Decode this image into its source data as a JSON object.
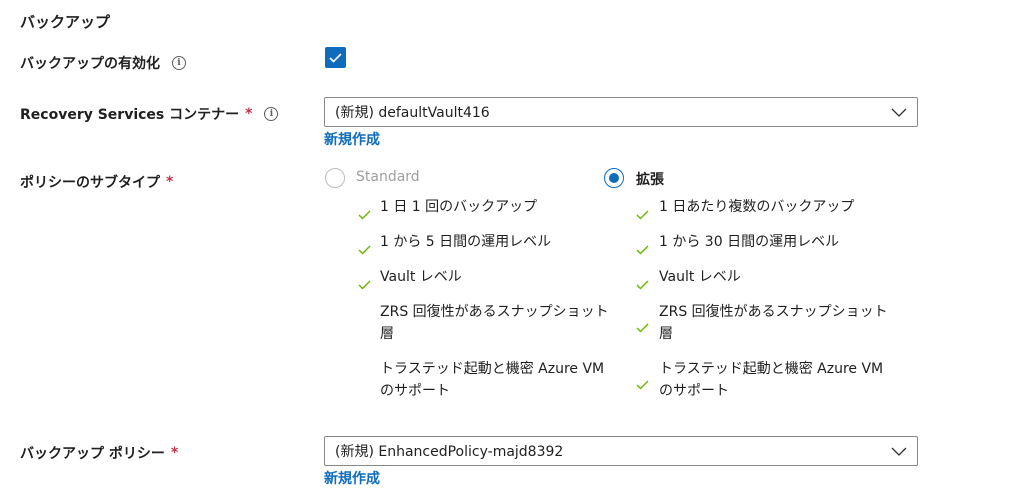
{
  "section": {
    "title": "バックアップ"
  },
  "enable_backup": {
    "label": "バックアップの有効化",
    "checked": true
  },
  "vault": {
    "label": "Recovery Services コンテナー",
    "required_mark": "*",
    "selected": "(新規) defaultVault416",
    "create_link": "新規作成"
  },
  "policy_subtype": {
    "label": "ポリシーのサブタイプ",
    "required_mark": "*",
    "options": [
      {
        "label": "Standard",
        "selected": false,
        "features": [
          {
            "text": "1 日 1 回のバックアップ",
            "check": true
          },
          {
            "text": "1 から 5 日間の運用レベル",
            "check": true
          },
          {
            "text": "Vault レベル",
            "check": true
          },
          {
            "text1": "ZRS 回復性があるスナップショット",
            "text2": "層",
            "check": false
          },
          {
            "text1": "トラステッド起動と機密 Azure VM",
            "text2": "のサポート",
            "check": false
          }
        ]
      },
      {
        "label": "拡張",
        "selected": true,
        "features": [
          {
            "text": "1 日あたり複数のバックアップ",
            "check": true
          },
          {
            "text": "1 から 30 日間の運用レベル",
            "check": true
          },
          {
            "text": "Vault レベル",
            "check": true
          },
          {
            "text1": "ZRS 回復性があるスナップショット",
            "text2": "層",
            "check": true
          },
          {
            "text1": "トラステッド起動と機密 Azure VM",
            "text2": "のサポート",
            "check": true
          }
        ]
      }
    ]
  },
  "backup_policy": {
    "label": "バックアップ ポリシー",
    "required_mark": "*",
    "selected": "(新規) EnhancedPolicy-majd8392",
    "create_link": "新規作成"
  },
  "colors": {
    "accent": "#0f6cbd",
    "required": "#c4314b",
    "check_green": "#6bb700",
    "disabled_text": "#a19f9d"
  }
}
